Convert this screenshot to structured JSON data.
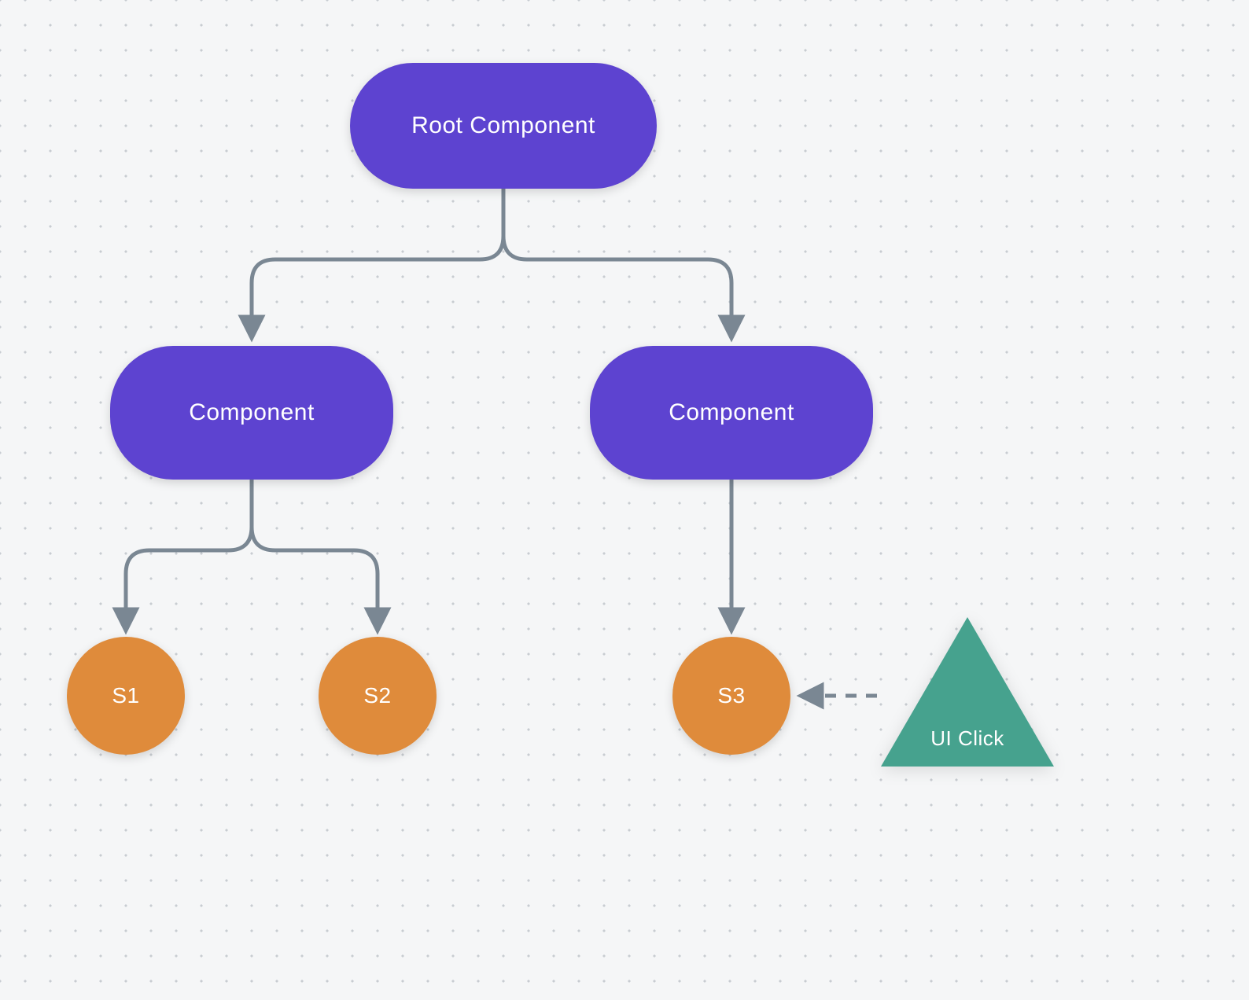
{
  "nodes": {
    "root": {
      "label": "Root Component"
    },
    "compL": {
      "label": "Component"
    },
    "compR": {
      "label": "Component"
    },
    "s1": {
      "label": "S1"
    },
    "s2": {
      "label": "S2"
    },
    "s3": {
      "label": "S3"
    },
    "uiClick": {
      "label": "UI Click"
    }
  },
  "colors": {
    "pill": "#5d43d0",
    "circle": "#df8b3b",
    "triangle": "#46a28e",
    "edge": "#7a8793"
  }
}
